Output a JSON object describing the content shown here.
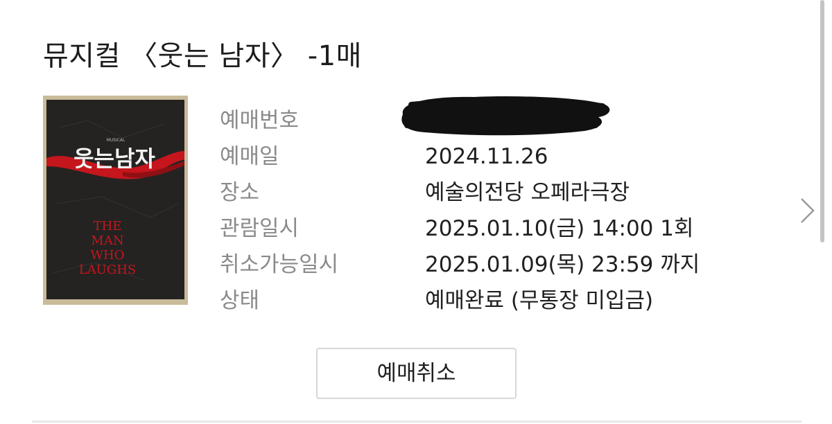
{
  "title": "뮤지컬 〈웃는 남자〉 -1매",
  "poster": {
    "small_caption": "MUSICAL",
    "korean_title": "웃는남자",
    "english_lines": [
      "THE",
      "MAN",
      "WHO",
      "LAUGHS"
    ]
  },
  "details": [
    {
      "label": "예매번호",
      "value": ""
    },
    {
      "label": "예매일",
      "value": "2024.11.26"
    },
    {
      "label": "장소",
      "value": "예술의전당 오페라극장"
    },
    {
      "label": "관람일시",
      "value": "2025.01.10(금) 14:00 1회"
    },
    {
      "label": "취소가능일시",
      "value": "2025.01.09(목) 23:59 까지"
    },
    {
      "label": "상태",
      "value": "예매완료 (무통장 미입금)"
    }
  ],
  "actions": {
    "cancel_label": "예매취소"
  },
  "icons": {
    "next": "chevron-right-icon"
  },
  "colors": {
    "label_gray": "#8a8a8a",
    "poster_red": "#c4161c",
    "poster_dark": "#1e1e1e"
  }
}
